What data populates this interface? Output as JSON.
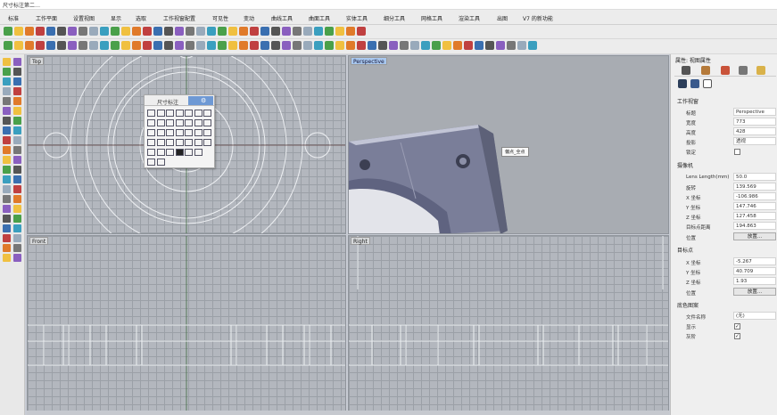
{
  "window": {
    "title": "尺寸标注第二…"
  },
  "menu": [
    "标准",
    "工作平面",
    "设置视图",
    "显示",
    "选取",
    "工作视窗配置",
    "可见性",
    "变动",
    "曲线工具",
    "曲面工具",
    "实体工具",
    "细分工具",
    "网格工具",
    "渲染工具",
    "出图",
    "V7 的新功能"
  ],
  "viewports": {
    "top": "Top",
    "perspective": "Perspective",
    "front": "Front",
    "right": "Right"
  },
  "floating_panel": {
    "title": "尺寸标注",
    "gear": "⚙"
  },
  "tooltip": "偏点_全点",
  "properties": {
    "title": "属性: 视图属性",
    "section_viewport": "工作视窗",
    "rows_viewport": [
      {
        "label": "标题",
        "value": "Perspective"
      },
      {
        "label": "宽度",
        "value": "773"
      },
      {
        "label": "高度",
        "value": "428"
      },
      {
        "label": "投影",
        "value": "透视"
      },
      {
        "label": "锁定",
        "value": ""
      }
    ],
    "section_camera": "摄像机",
    "rows_camera": [
      {
        "label": "Lens Length(mm)",
        "value": "50.0"
      },
      {
        "label": "旋转",
        "value": "139.569"
      },
      {
        "label": "X 坐标",
        "value": "-106.986"
      },
      {
        "label": "Y 坐标",
        "value": "147.746"
      },
      {
        "label": "Z 坐标",
        "value": "127.458"
      },
      {
        "label": "目标点距离",
        "value": "194.863"
      }
    ],
    "position_label": "位置",
    "place_button": "放置...",
    "section_target": "目标点",
    "rows_target": [
      {
        "label": "X 坐标",
        "value": "-5.267"
      },
      {
        "label": "Y 坐标",
        "value": "40.709"
      },
      {
        "label": "Z 坐标",
        "value": "1.93"
      }
    ],
    "target_position_label": "位置",
    "target_place_button": "放置...",
    "section_bg": "底色图案",
    "rows_bg": [
      {
        "label": "文件名称",
        "value": "(无)"
      },
      {
        "label": "显示",
        "value": "✓"
      },
      {
        "label": "灰阶",
        "value": "✓"
      }
    ]
  },
  "colors": {
    "accent": "#a9c8ef",
    "panel_blue": "#6e99d4"
  }
}
